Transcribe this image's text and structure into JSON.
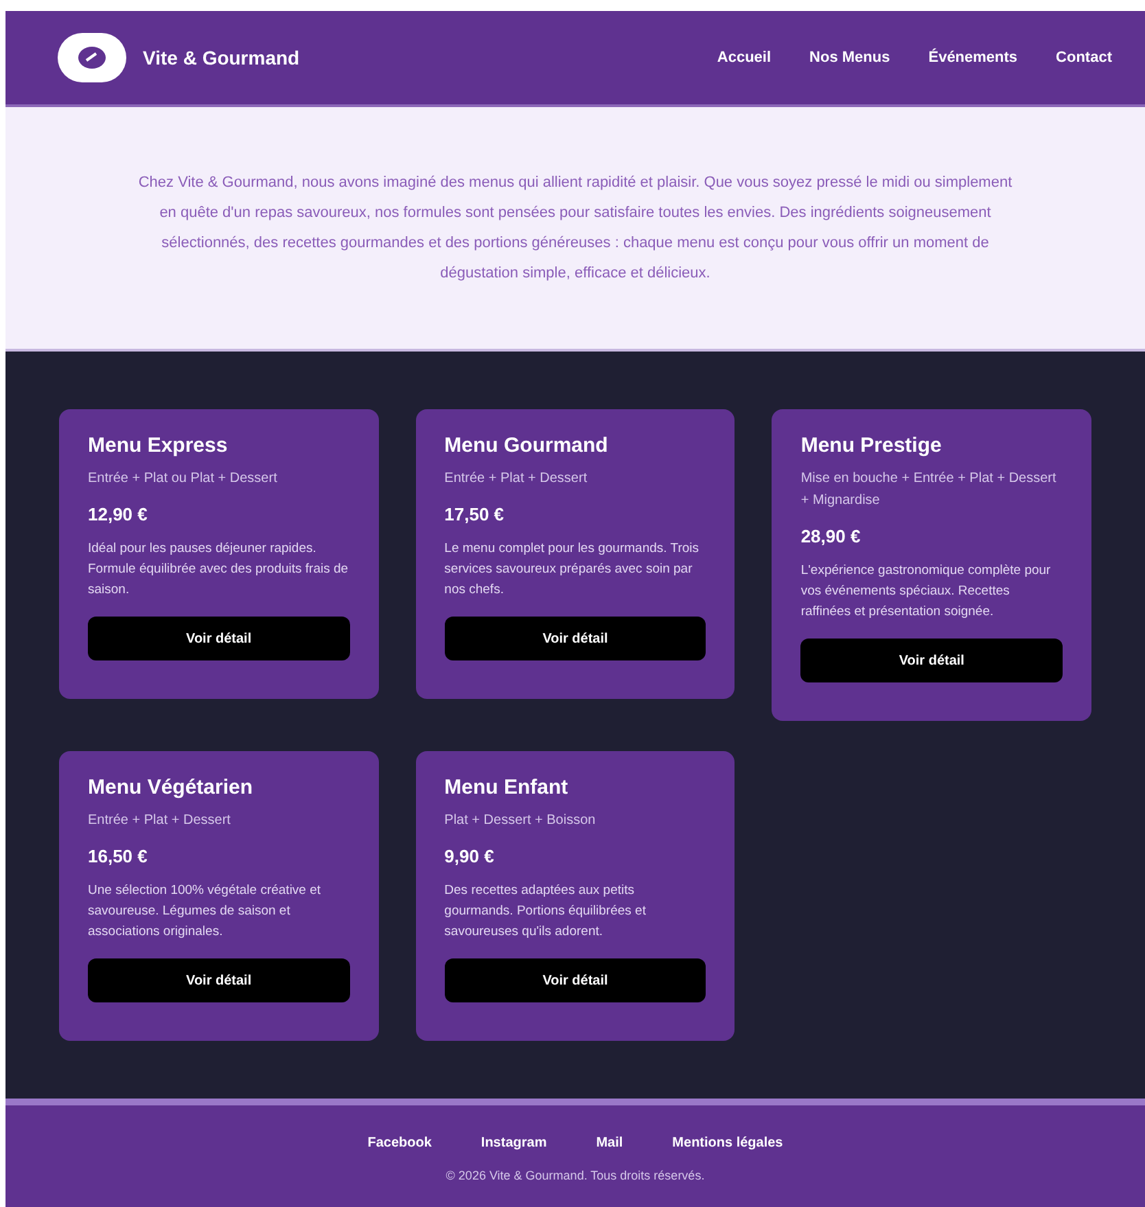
{
  "brand": {
    "name": "Vite & Gourmand"
  },
  "nav": [
    {
      "label": "Accueil"
    },
    {
      "label": "Nos Menus"
    },
    {
      "label": "Événements"
    },
    {
      "label": "Contact"
    }
  ],
  "intro": "Chez Vite & Gourmand, nous avons imaginé des menus qui allient rapidité et plaisir. Que vous soyez pressé le midi ou simplement en quête d'un repas savoureux, nos formules sont pensées pour satisfaire toutes les envies. Des ingrédients soigneusement sélectionnés, des recettes gourmandes et des portions généreuses : chaque menu est conçu pour vous offrir un moment de dégustation simple, efficace et délicieux.",
  "menus": [
    {
      "title": "Menu Express",
      "formula": "Entrée + Plat ou Plat + Dessert",
      "price": "12,90 €",
      "description": "Idéal pour les pauses déjeuner rapides. Formule équilibrée avec des produits frais de saison.",
      "button": "Voir détail"
    },
    {
      "title": "Menu Gourmand",
      "formula": "Entrée + Plat + Dessert",
      "price": "17,50 €",
      "description": "Le menu complet pour les gourmands. Trois services savoureux préparés avec soin par nos chefs.",
      "button": "Voir détail"
    },
    {
      "title": "Menu Prestige",
      "formula": "Mise en bouche + Entrée + Plat + Dessert + Mignardise",
      "price": "28,90 €",
      "description": "L'expérience gastronomique complète pour vos événements spéciaux. Recettes raffinées et présentation soignée.",
      "button": "Voir détail"
    },
    {
      "title": "Menu Végétarien",
      "formula": "Entrée + Plat + Dessert",
      "price": "16,50 €",
      "description": "Une sélection 100% végétale créative et savoureuse. Légumes de saison et associations originales.",
      "button": "Voir détail"
    },
    {
      "title": "Menu Enfant",
      "formula": "Plat + Dessert + Boisson",
      "price": "9,90 €",
      "description": "Des recettes adaptées aux petits gourmands. Portions équilibrées et savoureuses qu'ils adorent.",
      "button": "Voir détail"
    }
  ],
  "footer": {
    "links": [
      {
        "label": "Facebook"
      },
      {
        "label": "Instagram"
      },
      {
        "label": "Mail"
      },
      {
        "label": "Mentions légales"
      }
    ],
    "copyright": "© 2026 Vite & Gourmand. Tous droits réservés."
  }
}
